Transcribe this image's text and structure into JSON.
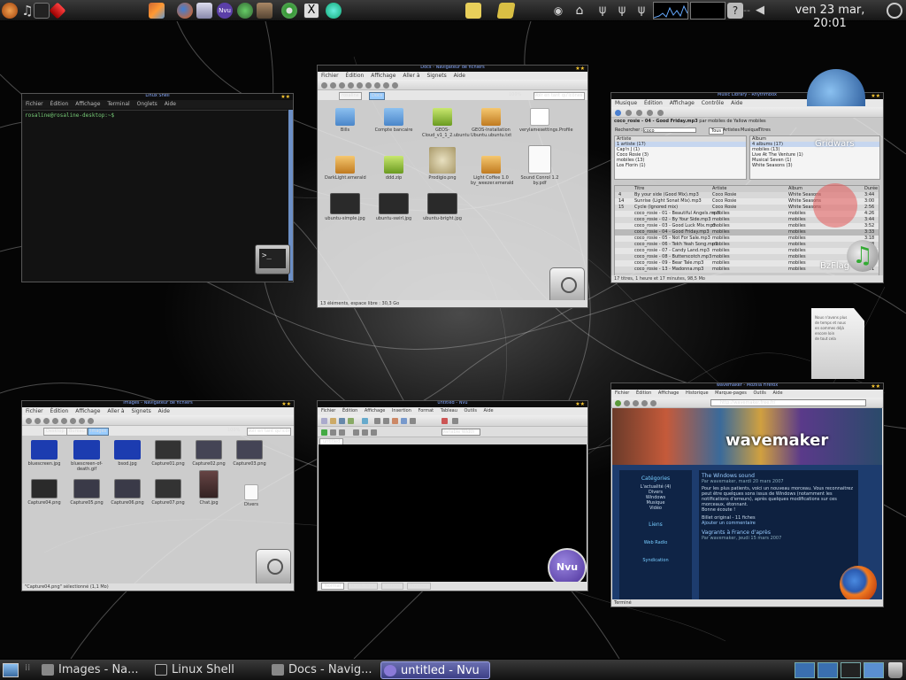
{
  "desktop": {
    "clock": "ven 23 mar, 20:01"
  },
  "taskbar": {
    "tasks": [
      {
        "label": "Images - Na..."
      },
      {
        "label": "Linux Shell"
      },
      {
        "label": "Docs - Navig..."
      },
      {
        "label": "untitled - Nvu"
      }
    ]
  },
  "windows": {
    "terminal": {
      "title": "Linux Shell",
      "menu": [
        "Fichier",
        "Édition",
        "Affichage",
        "Terminal",
        "Onglets",
        "Aide"
      ],
      "prompt": "rosaline@rosaline-desktop:~$"
    },
    "docs": {
      "title": "Docs - Navigateur de fichiers",
      "menu": [
        "Fichier",
        "Édition",
        "Affichage",
        "Aller à",
        "Signets",
        "Aide"
      ],
      "path": [
        "rosaline",
        "Docs"
      ],
      "zoom": "100%",
      "view": "Voir en tant qu'icônes",
      "files": [
        {
          "name": "Bills"
        },
        {
          "name": "Compte bancaire"
        },
        {
          "name": "GEOS-Cloud_v1_1_2.ubuntu"
        },
        {
          "name": "GEOS-Installation Ubuntu.ubuntu.txt"
        },
        {
          "name": "verylamesettings.Profile"
        },
        {
          "name": "DarkLight.emerald"
        },
        {
          "name": "ddd.zip"
        },
        {
          "name": "Prodigio.png"
        },
        {
          "name": "Light Coffee 1.0 by_weezer.emerald"
        },
        {
          "name": "Sound Conrol 1.2 by.pdf"
        },
        {
          "name": "ubuntu-simple.jpg"
        },
        {
          "name": "ubuntu-swirl.jpg"
        },
        {
          "name": "ubuntu-bright.jpg"
        }
      ],
      "status": "13 éléments, espace libre : 30,3 Go"
    },
    "music": {
      "title": "Music Library - Rhythmbox",
      "menu": [
        "Musique",
        "Édition",
        "Affichage",
        "Contrôle",
        "Aide"
      ],
      "now_playing": "coco_rosie - 04 - Good Friday.mp3",
      "now_playing_by": "par mobiles de Yallow mobiles",
      "search_label": "Rechercher :",
      "search_value": "coco",
      "filter_tabs": [
        "Tous",
        "Artistes",
        "Musique",
        "Titres"
      ],
      "artist_header": "Artiste",
      "artists": [
        "1 artiste (17)",
        "Cap'n J (1)",
        "Coco Rosie (3)",
        "mobiles (13)",
        "Los Florin (1)"
      ],
      "album_header": "Album",
      "albums": [
        "4 albums (17)",
        "mobiles (13)",
        "Live At The Venture (1)",
        "Musical Seven (1)",
        "White Seasons (3)"
      ],
      "side_labels": [
        "Gridwars",
        "BzFlag"
      ],
      "columns": [
        "Titre",
        "Artiste",
        "Album",
        "Durée"
      ],
      "tracks": [
        {
          "no": "4",
          "title": "By your side (Good Mix).mp3",
          "artist": "Coco Rosie",
          "album": "White Seasons",
          "time": "3:44"
        },
        {
          "no": "14",
          "title": "Sunrise (Light Sonat Mix).mp3",
          "artist": "Coco Rosie",
          "album": "White Seasons",
          "time": "3:00"
        },
        {
          "no": "15",
          "title": "Cycle (Ignored mix)",
          "artist": "Coco Rosie",
          "album": "White Seasons",
          "time": "2:56"
        },
        {
          "no": "",
          "title": "coco_rosie - 01 - Beautiful Angels.mp3",
          "artist": "mobiles",
          "album": "mobiles",
          "time": "4:26"
        },
        {
          "no": "",
          "title": "coco_rosie - 02 - By Your Side.mp3",
          "artist": "mobiles",
          "album": "mobiles",
          "time": "3:44"
        },
        {
          "no": "",
          "title": "coco_rosie - 03 - Good Luck Mix.mp3",
          "artist": "mobiles",
          "album": "mobiles",
          "time": "3:52"
        },
        {
          "no": "",
          "title": "coco_rosie - 04 - Good Friday.mp3",
          "artist": "mobiles",
          "album": "mobiles",
          "time": "3:33"
        },
        {
          "no": "",
          "title": "coco_rosie - 05 - Not For Sale.mp3",
          "artist": "mobiles",
          "album": "mobiles",
          "time": "3:18"
        },
        {
          "no": "",
          "title": "coco_rosie - 06 - Tekh Yeah Song.mp3",
          "artist": "mobiles",
          "album": "mobiles",
          "time": "3:58"
        },
        {
          "no": "",
          "title": "coco_rosie - 07 - Candy Land.mp3",
          "artist": "mobiles",
          "album": "mobiles",
          "time": "2:53"
        },
        {
          "no": "",
          "title": "coco_rosie - 08 - Butterscotch.mp3",
          "artist": "mobiles",
          "album": "mobiles",
          "time": "3:40"
        },
        {
          "no": "",
          "title": "coco_rosie - 09 - Bear Tale.mp3",
          "artist": "mobiles",
          "album": "mobiles",
          "time": "3:22"
        },
        {
          "no": "",
          "title": "coco_rosie - 13 - Madonna.mp3",
          "artist": "mobiles",
          "album": "mobiles",
          "time": "3:01"
        }
      ],
      "status": "17 titres, 1 heure et 17 minutes, 98,5 Mo"
    },
    "images": {
      "title": "Images - Navigateur de fichiers",
      "path": [
        "Desktop",
        "Bureau",
        "Images"
      ],
      "zoom": "100%",
      "view": "Voir en tant qu'icônes",
      "files": [
        {
          "name": "bluescreen.jpg"
        },
        {
          "name": "bluescreen-of-death.gif"
        },
        {
          "name": "bsod.jpg"
        },
        {
          "name": "Capture01.png"
        },
        {
          "name": "Capture02.png"
        },
        {
          "name": "Capture03.png"
        },
        {
          "name": "Capture04.png"
        },
        {
          "name": "Capture05.png"
        },
        {
          "name": "Capture06.png"
        },
        {
          "name": "Capture07.png"
        },
        {
          "name": "Chat.jpg"
        },
        {
          "name": "Divers"
        }
      ],
      "status": "\"Capture04.png\" sélectionné (1,1 Mo)"
    },
    "nvu": {
      "title": "untitled - Nvu",
      "menu": [
        "Fichier",
        "Édition",
        "Affichage",
        "Insertion",
        "Format",
        "Tableau",
        "Outils",
        "Aide"
      ],
      "style_select": "Variable Width",
      "tab": "untitled",
      "bottom_tabs": [
        "Normal",
        "HTML Tags",
        "Source",
        "Preview"
      ]
    },
    "firefox": {
      "title": "wavemaker - Mozilla Firefox",
      "menu": [
        "Fichier",
        "Édition",
        "Affichage",
        "Historique",
        "Marque-pages",
        "Outils",
        "Aide"
      ],
      "url": "http://wavemaker.free.fr/",
      "site_title": "wavemaker",
      "categories_title": "Catégories",
      "categories": [
        "L'actualité (4)",
        "Divers",
        "Windows",
        "Musique",
        "Vidéo"
      ],
      "links_title": "Liens",
      "post1_title": "The Windows sound",
      "post1_meta": "Par wavemaker, mardi 20 mars 2007",
      "post1_text": "Pour les plus patients, voici un nouveau morceau. Vous reconnaitrez peut être quelques sons issus de Windows (notamment les notifications d'erreurs), après quelques modifications sur ces morceaux, étonnant.",
      "post1_more": "Bonne écoute !",
      "post1_footer": "Billet original - 11 fiches",
      "post1_add": "Ajouter un commentaire",
      "post2_title": "Vagrants à France d'après",
      "post2_meta": "Par wavemaker, jeudi 15 mars 2007",
      "webradio": "Web Radio",
      "syndication": "Syndication",
      "status": "Terminé"
    },
    "text_doc": {
      "lines": [
        "Nous n'avons plus",
        "de temps et nous",
        "en sommes déjà",
        "encore loin",
        "de tout cela"
      ]
    }
  }
}
